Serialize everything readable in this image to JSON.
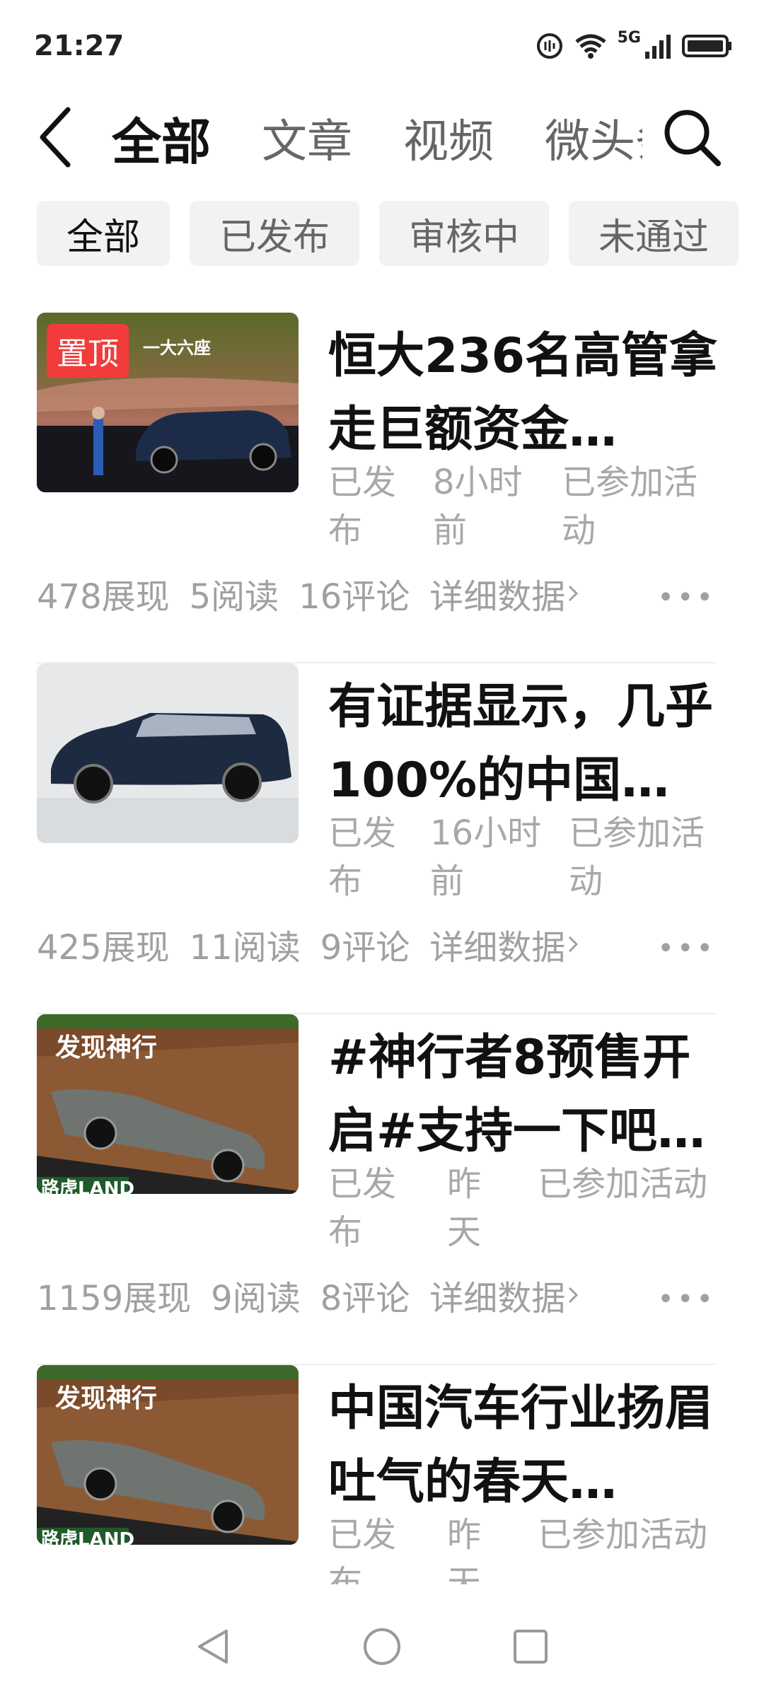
{
  "status": {
    "time": "21:27",
    "network": "5G"
  },
  "tabs": [
    "全部",
    "文章",
    "视频",
    "微头条"
  ],
  "chips": [
    "全部",
    "已发布",
    "审核中",
    "未通过"
  ],
  "pin_label": "置顶",
  "detail_label": "详细数据",
  "items": [
    {
      "title": "恒大236名高管拿走巨额资金…",
      "status": "已发布",
      "time": "8小时前",
      "activity": "已参加活动",
      "views": "478展现",
      "reads": "5阅读",
      "comments": "16评论",
      "pinned": true,
      "thumb_caption": "一大六座"
    },
    {
      "title": "有证据显示，几乎100%的中国…",
      "status": "已发布",
      "time": "16小时前",
      "activity": "已参加活动",
      "views": "425展现",
      "reads": "11阅读",
      "comments": "9评论",
      "pinned": false
    },
    {
      "title": "#神行者8预售开启#支持一下吧…",
      "status": "已发布",
      "time": "昨天",
      "activity": "已参加活动",
      "views": "1159展现",
      "reads": "9阅读",
      "comments": "8评论",
      "pinned": false,
      "thumb_caption": "发现神行",
      "thumb_brand": "路虎LAND"
    },
    {
      "title": "中国汽车行业扬眉吐气的春天…",
      "status": "已发布",
      "time": "昨天",
      "activity": "已参加活动",
      "pinned": false,
      "thumb_caption": "发现神行",
      "thumb_brand": "路虎LAND"
    }
  ],
  "colors": {
    "pin_red": "#f23b3b",
    "muted": "#a8a8a8"
  }
}
